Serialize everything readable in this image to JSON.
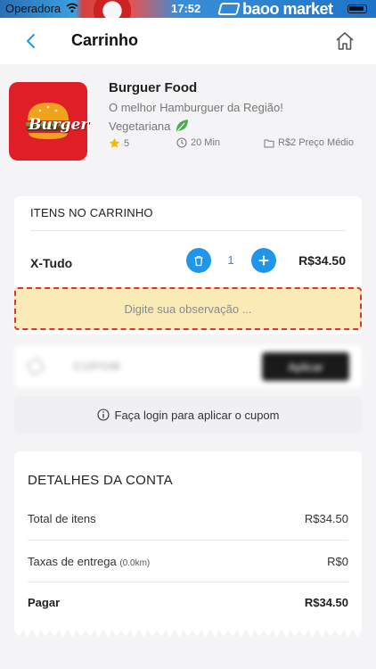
{
  "status_bar": {
    "carrier": "Operadora",
    "time": "17:52",
    "ad_brand": "baoo market"
  },
  "header": {
    "title": "Carrinho",
    "back_icon": "chevron-left-icon",
    "home_icon": "home-icon"
  },
  "store": {
    "logo_text": "Burger",
    "name": "Burguer Food",
    "description": "O melhor Hamburguer da Região!",
    "category": "Vegetariana",
    "rating": "5",
    "delivery_time": "20 Min",
    "avg_price": "R$2 Preço Médio"
  },
  "cart": {
    "heading": "ITENS NO CARRINHO",
    "items": [
      {
        "name": "X-Tudo",
        "quantity": "1",
        "price": "R$34.50"
      }
    ],
    "observation_placeholder": "Digite sua observação ..."
  },
  "coupon": {
    "label": "CUPOM",
    "apply_label": "Aplicar",
    "login_note": "Faça login para aplicar o cupom"
  },
  "account": {
    "heading": "DETALHES DA CONTA",
    "rows": [
      {
        "label": "Total de itens",
        "note": "",
        "value": "R$34.50"
      },
      {
        "label": "Taxas de entrega",
        "note": "(0.0km)",
        "value": "R$0"
      },
      {
        "label": "Pagar",
        "note": "",
        "value": "R$34.50"
      }
    ]
  },
  "colors": {
    "accent": "#2196e8",
    "logo_bg": "#e01e26",
    "observation_bg": "#faebb6",
    "observation_border": "#e03232",
    "leaf": "#4caf50"
  }
}
